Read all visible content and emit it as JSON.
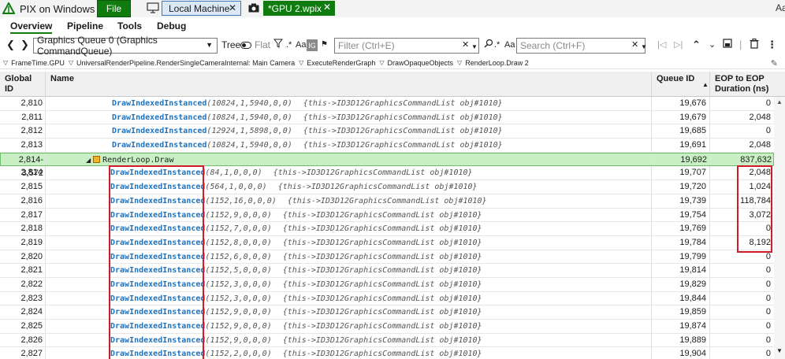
{
  "app": {
    "title": "PIX on Windows",
    "user_abbr": "Aa"
  },
  "titlebar": {
    "file_label": "File",
    "machine_tab": "Local Machine",
    "capture_tab": "*GPU 2.wpix",
    "close_glyph": "✕"
  },
  "nav": {
    "tabs": [
      "Overview",
      "Pipeline",
      "Tools",
      "Debug"
    ],
    "active": "Overview"
  },
  "toolbar": {
    "queue_value": "Graphics Queue 0 (Graphics CommandQueue)",
    "tree_label": "Tree",
    "flat_label": "Flat",
    "regex_label": ".*",
    "case_label": "Aa",
    "ig_label": "IG",
    "filter_placeholder": "Filter (Ctrl+E)",
    "search_regex": ".*",
    "search_case": "Aa",
    "search_placeholder": "Search (Ctrl+F)"
  },
  "breadcrumb": [
    "FrameTime.GPU",
    "UniversalRenderPipeline.RenderSingleCameraInternal: Main Camera",
    "ExecuteRenderGraph",
    "DrawOpaqueObjects",
    "RenderLoop.Draw 2"
  ],
  "columns": {
    "global_id": "Global ID",
    "name": "Name",
    "queue_id": "Queue ID",
    "duration": "EOP to EOP Duration (ns)"
  },
  "rows": [
    {
      "gid": "2,810",
      "fn": "DrawIndexedInstanced",
      "args": "(10824,1,5940,0,0)",
      "obj": "{this->ID3D12GraphicsCommandList obj#1010}",
      "qid": "19,676",
      "dur": "0",
      "level": 0
    },
    {
      "gid": "2,811",
      "fn": "DrawIndexedInstanced",
      "args": "(10824,1,5940,0,0)",
      "obj": "{this->ID3D12GraphicsCommandList obj#1010}",
      "qid": "19,679",
      "dur": "2,048",
      "level": 0
    },
    {
      "gid": "2,812",
      "fn": "DrawIndexedInstanced",
      "args": "(12924,1,5898,0,0)",
      "obj": "{this->ID3D12GraphicsCommandList obj#1010}",
      "qid": "19,685",
      "dur": "0",
      "level": 0
    },
    {
      "gid": "2,813",
      "fn": "DrawIndexedInstanced",
      "args": "(10824,1,5940,0,0)",
      "obj": "{this->ID3D12GraphicsCommandList obj#1010}",
      "qid": "19,691",
      "dur": "2,048",
      "level": 0
    },
    {
      "gid": "2,814-3,572",
      "group": "RenderLoop.Draw",
      "qid": "19,692",
      "dur": "837,632"
    },
    {
      "gid": "2,814",
      "fn": "DrawIndexedInstanced",
      "args": "(84,1,0,0,0)",
      "obj": "{this->ID3D12GraphicsCommandList obj#1010}",
      "qid": "19,707",
      "dur": "2,048",
      "level": 1
    },
    {
      "gid": "2,815",
      "fn": "DrawIndexedInstanced",
      "args": "(564,1,0,0,0)",
      "obj": "{this->ID3D12GraphicsCommandList obj#1010}",
      "qid": "19,720",
      "dur": "1,024",
      "level": 1
    },
    {
      "gid": "2,816",
      "fn": "DrawIndexedInstanced",
      "args": "(1152,16,0,0,0)",
      "obj": "{this->ID3D12GraphicsCommandList obj#1010}",
      "qid": "19,739",
      "dur": "118,784",
      "level": 1
    },
    {
      "gid": "2,817",
      "fn": "DrawIndexedInstanced",
      "args": "(1152,9,0,0,0)",
      "obj": "{this->ID3D12GraphicsCommandList obj#1010}",
      "qid": "19,754",
      "dur": "3,072",
      "level": 1
    },
    {
      "gid": "2,818",
      "fn": "DrawIndexedInstanced",
      "args": "(1152,7,0,0,0)",
      "obj": "{this->ID3D12GraphicsCommandList obj#1010}",
      "qid": "19,769",
      "dur": "0",
      "level": 1
    },
    {
      "gid": "2,819",
      "fn": "DrawIndexedInstanced",
      "args": "(1152,8,0,0,0)",
      "obj": "{this->ID3D12GraphicsCommandList obj#1010}",
      "qid": "19,784",
      "dur": "8,192",
      "level": 1
    },
    {
      "gid": "2,820",
      "fn": "DrawIndexedInstanced",
      "args": "(1152,6,0,0,0)",
      "obj": "{this->ID3D12GraphicsCommandList obj#1010}",
      "qid": "19,799",
      "dur": "0",
      "level": 1
    },
    {
      "gid": "2,821",
      "fn": "DrawIndexedInstanced",
      "args": "(1152,5,0,0,0)",
      "obj": "{this->ID3D12GraphicsCommandList obj#1010}",
      "qid": "19,814",
      "dur": "0",
      "level": 1
    },
    {
      "gid": "2,822",
      "fn": "DrawIndexedInstanced",
      "args": "(1152,3,0,0,0)",
      "obj": "{this->ID3D12GraphicsCommandList obj#1010}",
      "qid": "19,829",
      "dur": "0",
      "level": 1
    },
    {
      "gid": "2,823",
      "fn": "DrawIndexedInstanced",
      "args": "(1152,3,0,0,0)",
      "obj": "{this->ID3D12GraphicsCommandList obj#1010}",
      "qid": "19,844",
      "dur": "0",
      "level": 1
    },
    {
      "gid": "2,824",
      "fn": "DrawIndexedInstanced",
      "args": "(1152,9,0,0,0)",
      "obj": "{this->ID3D12GraphicsCommandList obj#1010}",
      "qid": "19,859",
      "dur": "0",
      "level": 1
    },
    {
      "gid": "2,825",
      "fn": "DrawIndexedInstanced",
      "args": "(1152,9,0,0,0)",
      "obj": "{this->ID3D12GraphicsCommandList obj#1010}",
      "qid": "19,874",
      "dur": "0",
      "level": 1
    },
    {
      "gid": "2,826",
      "fn": "DrawIndexedInstanced",
      "args": "(1152,9,0,0,0)",
      "obj": "{this->ID3D12GraphicsCommandList obj#1010}",
      "qid": "19,889",
      "dur": "0",
      "level": 1
    },
    {
      "gid": "2,827",
      "fn": "DrawIndexedInstanced",
      "args": "(1152,2,0,0,0)",
      "obj": "{this->ID3D12GraphicsCommandList obj#1010}",
      "qid": "19,904",
      "dur": "0",
      "level": 1
    }
  ],
  "colors": {
    "accent": "#107c10",
    "highlight": "#d11a2a",
    "function_name": "#1e73be",
    "group_row": "#c9efc5"
  }
}
